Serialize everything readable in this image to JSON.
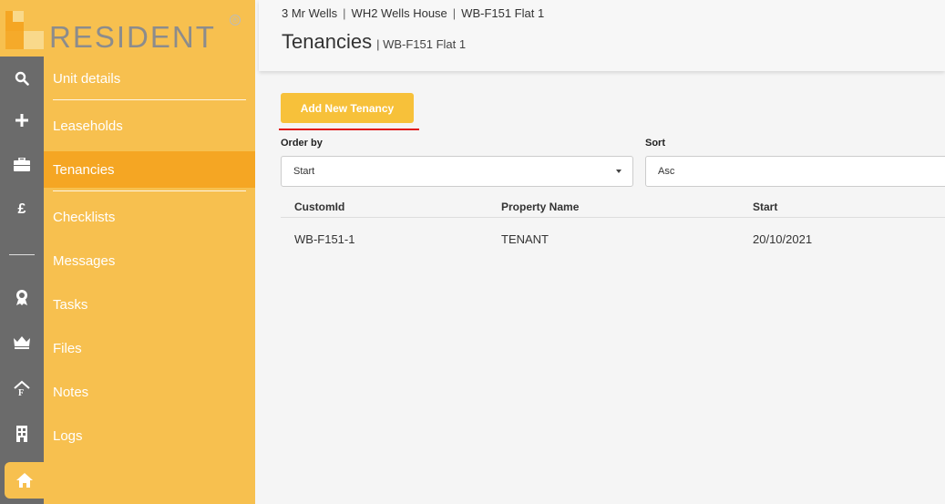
{
  "rail": {
    "icons": [
      "search-icon",
      "plus-icon",
      "briefcase-icon",
      "pound-icon",
      "seal-icon",
      "crown-icon",
      "house-f-icon",
      "building-icon",
      "home-icon"
    ]
  },
  "nav": {
    "brand": "RESIDENT",
    "brand_mark": "®",
    "items": [
      {
        "label": "Unit details"
      },
      {
        "label": "Leaseholds"
      },
      {
        "label": "Tenancies"
      },
      {
        "label": "Checklists"
      },
      {
        "label": "Messages"
      },
      {
        "label": "Tasks"
      },
      {
        "label": "Files"
      },
      {
        "label": "Notes"
      },
      {
        "label": "Logs"
      }
    ],
    "active": "Tenancies"
  },
  "header": {
    "breadcrumb": [
      "3 Mr Wells",
      "WH2 Wells House",
      "WB-F151 Flat 1"
    ],
    "separator": "|",
    "title": "Tenancies",
    "subtitle": "| WB-F151 Flat 1"
  },
  "actions": {
    "add_label": "Add New Tenancy"
  },
  "filters": {
    "order_by_label": "Order by",
    "order_by_value": "Start",
    "sort_label": "Sort",
    "sort_value": "Asc"
  },
  "table": {
    "columns": [
      "CustomId",
      "Property Name",
      "Start"
    ],
    "rows": [
      [
        "WB-F151-1",
        "TENANT",
        "20/10/2021"
      ]
    ]
  },
  "colors": {
    "nav_bg": "#f7c04f",
    "nav_active": "#f5a623",
    "rail_bg": "#6b6b6b",
    "button": "#f7c13a",
    "underline": "#e01b1b"
  }
}
